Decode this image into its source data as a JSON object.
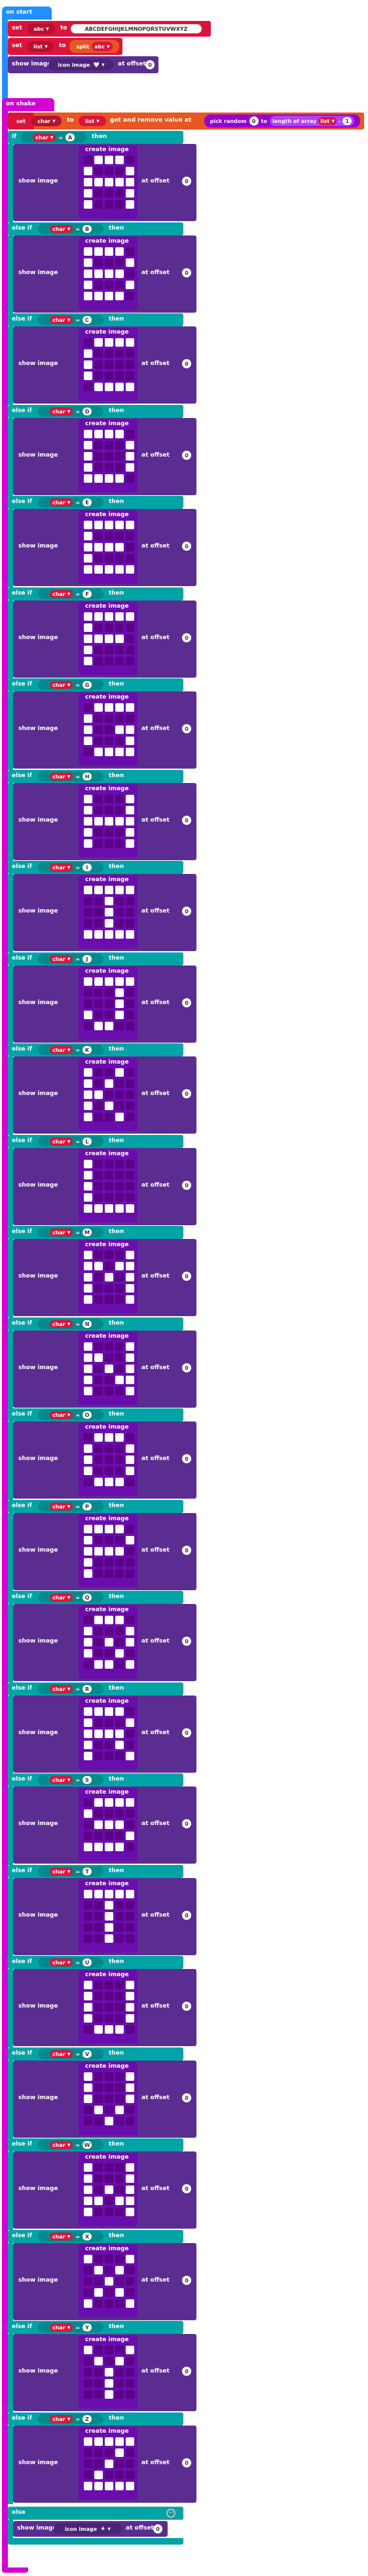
{
  "on_start": {
    "hat_label": "on start",
    "set_abc": {
      "set": "set",
      "var": "abc",
      "to": "to",
      "value": "ABCDEFGHIJKLMNOPQRSTUVWXYZ"
    },
    "set_list": {
      "set": "set",
      "var": "list",
      "to": "to",
      "split": "split",
      "split_var": "abc",
      "at": "at",
      "index": "0"
    },
    "show_image": {
      "label": "show image",
      "icon_image": "icon image",
      "offset_label": "at offset",
      "offset": "0"
    }
  },
  "on_shake": {
    "hat_label": "on shake",
    "set_char": {
      "set": "set",
      "var": "char",
      "to": "to",
      "list_var": "list",
      "get_remove": "get and remove value at",
      "pick_random": "pick random",
      "from": "0",
      "to_label": "to",
      "length_of": "length of array",
      "array_var": "list",
      "minus": "-",
      "one": "1"
    },
    "if_label": "if",
    "else_if_label": "else if",
    "else_label": "else",
    "then_label": "then",
    "char_var": "char",
    "eq": "=",
    "create_image": "create image",
    "show_image": "show image",
    "at_offset": "at offset",
    "offset": "0",
    "branches": [
      {
        "letter": "A",
        "rows": [
          "01110",
          "10001",
          "11111",
          "10001",
          "10001"
        ]
      },
      {
        "letter": "B",
        "rows": [
          "11110",
          "10001",
          "11110",
          "10001",
          "11110"
        ]
      },
      {
        "letter": "C",
        "rows": [
          "01111",
          "10000",
          "10000",
          "10000",
          "01111"
        ]
      },
      {
        "letter": "D",
        "rows": [
          "11110",
          "10001",
          "10001",
          "10001",
          "11110"
        ]
      },
      {
        "letter": "E",
        "rows": [
          "11111",
          "10000",
          "11110",
          "10000",
          "11111"
        ]
      },
      {
        "letter": "F",
        "rows": [
          "11111",
          "10000",
          "11110",
          "10000",
          "10000"
        ]
      },
      {
        "letter": "G",
        "rows": [
          "01111",
          "10000",
          "10011",
          "10001",
          "01111"
        ]
      },
      {
        "letter": "H",
        "rows": [
          "10001",
          "10001",
          "11111",
          "10001",
          "10001"
        ]
      },
      {
        "letter": "I",
        "rows": [
          "11111",
          "00100",
          "00100",
          "00100",
          "11111"
        ]
      },
      {
        "letter": "J",
        "rows": [
          "11111",
          "00010",
          "00010",
          "10010",
          "01100"
        ]
      },
      {
        "letter": "K",
        "rows": [
          "10010",
          "10100",
          "11000",
          "10100",
          "10010"
        ]
      },
      {
        "letter": "L",
        "rows": [
          "10000",
          "10000",
          "10000",
          "10000",
          "11111"
        ]
      },
      {
        "letter": "M",
        "rows": [
          "10001",
          "11011",
          "10101",
          "10001",
          "10001"
        ]
      },
      {
        "letter": "N",
        "rows": [
          "10001",
          "11001",
          "10101",
          "10011",
          "10001"
        ]
      },
      {
        "letter": "O",
        "rows": [
          "01110",
          "10001",
          "10001",
          "10001",
          "01110"
        ]
      },
      {
        "letter": "P",
        "rows": [
          "11110",
          "10001",
          "11110",
          "10000",
          "10000"
        ]
      },
      {
        "letter": "Q",
        "rows": [
          "01110",
          "10001",
          "10101",
          "10010",
          "01101"
        ]
      },
      {
        "letter": "R",
        "rows": [
          "11110",
          "10001",
          "11110",
          "10010",
          "10001"
        ]
      },
      {
        "letter": "S",
        "rows": [
          "01111",
          "10000",
          "01110",
          "00001",
          "11110"
        ]
      },
      {
        "letter": "T",
        "rows": [
          "11111",
          "00100",
          "00100",
          "00100",
          "00100"
        ]
      },
      {
        "letter": "U",
        "rows": [
          "10001",
          "10001",
          "10001",
          "10001",
          "01110"
        ]
      },
      {
        "letter": "V",
        "rows": [
          "10001",
          "10001",
          "10001",
          "01010",
          "00100"
        ]
      },
      {
        "letter": "W",
        "rows": [
          "10001",
          "10001",
          "10101",
          "11011",
          "10001"
        ]
      },
      {
        "letter": "X",
        "rows": [
          "10001",
          "01010",
          "00100",
          "01010",
          "10001"
        ]
      },
      {
        "letter": "Y",
        "rows": [
          "10001",
          "01010",
          "00100",
          "00100",
          "00100"
        ]
      },
      {
        "letter": "Z",
        "rows": [
          "11111",
          "00010",
          "00100",
          "01000",
          "11111"
        ]
      }
    ],
    "else_show_image": {
      "label": "show image",
      "icon_image": "icon image",
      "offset_label": "at offset",
      "offset": "0"
    }
  },
  "colors": {
    "event": "#1e90ff",
    "variables": "#dc143c",
    "images": "#5c2d91",
    "logic": "#00a4a6",
    "shake_hat": "#d400d4",
    "arrays": "#e65722",
    "math": "#9400d3"
  }
}
